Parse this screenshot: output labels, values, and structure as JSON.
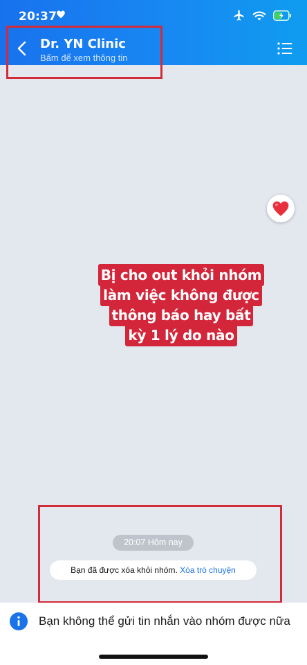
{
  "status_bar": {
    "time": "20:37",
    "icons": [
      "heart-icon",
      "airplane-icon",
      "wifi-icon",
      "battery-charging-icon"
    ]
  },
  "header": {
    "title": "Dr. YN Clinic",
    "subtitle": "Bấm để xem thông tin"
  },
  "chat": {
    "reaction": "heart",
    "caption_lines": [
      "Bị cho out khỏi nhóm",
      "làm việc không được",
      "thông báo hay bất",
      "kỳ 1 lý do nào"
    ],
    "time_pill": "20:07 Hôm nay",
    "system_message": "Bạn đã được xóa khỏi nhóm.",
    "system_action": "Xóa trò chuyện"
  },
  "footer": {
    "notice": "Bạn không thể gửi tin nhắn vào nhóm được nữa"
  },
  "colors": {
    "header": "#1a7ff0",
    "annotation": "#d22b3a",
    "caption_bg": "#d3263a",
    "link": "#1a73e8"
  }
}
